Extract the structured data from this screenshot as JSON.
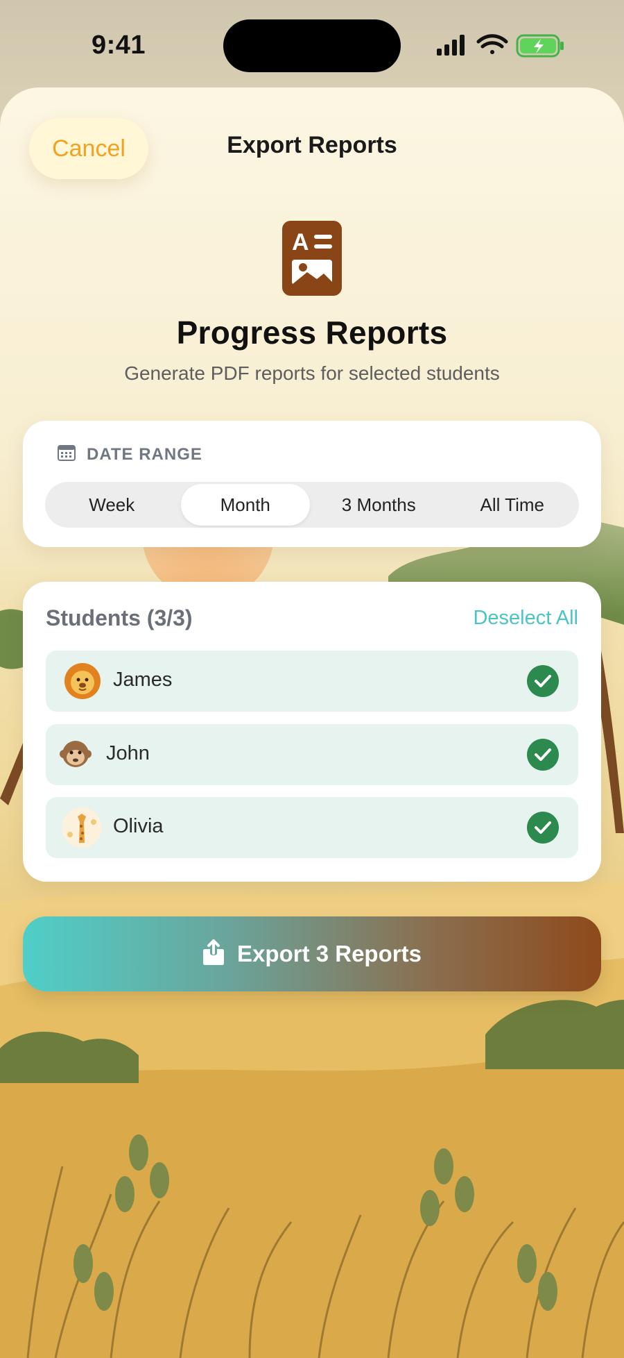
{
  "status_bar": {
    "time": "9:41",
    "icons": [
      "signal-icon",
      "wifi-icon",
      "battery-charging-icon"
    ]
  },
  "nav": {
    "cancel_label": "Cancel",
    "title": "Export Reports"
  },
  "hero": {
    "icon": "report-document-icon",
    "title": "Progress Reports",
    "subtitle": "Generate PDF reports for selected students"
  },
  "date_range": {
    "header_icon": "calendar-icon",
    "label": "DATE RANGE",
    "options": [
      "Week",
      "Month",
      "3 Months",
      "All Time"
    ],
    "selected": "Month"
  },
  "students": {
    "title": "Students (3/3)",
    "deselect_label": "Deselect All",
    "items": [
      {
        "name": "James",
        "avatar": "lion-avatar-icon",
        "selected": true
      },
      {
        "name": "John",
        "avatar": "monkey-avatar-icon",
        "selected": true
      },
      {
        "name": "Olivia",
        "avatar": "giraffe-avatar-icon",
        "selected": true
      }
    ]
  },
  "export": {
    "label": "Export 3 Reports",
    "icon": "share-upload-icon"
  },
  "colors": {
    "accent_orange": "#f3a121",
    "accent_teal": "#49c5c3",
    "brown": "#8a4516",
    "check_green": "#2c8a4f"
  }
}
